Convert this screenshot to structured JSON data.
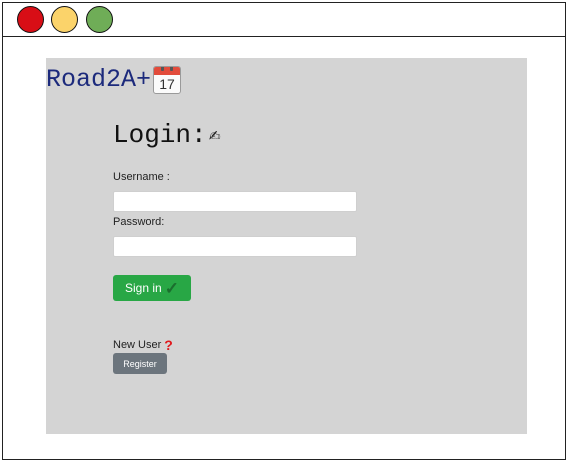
{
  "window": {
    "controls": [
      {
        "name": "close",
        "color": "#d80e16"
      },
      {
        "name": "minimize",
        "color": "#fbd36a"
      },
      {
        "name": "maximize",
        "color": "#6fad57"
      }
    ]
  },
  "brand": {
    "title": "Road2A+",
    "calendar_icon_number": "17",
    "color": "#1c2a7c"
  },
  "login": {
    "heading": "Login:",
    "heading_icon": "writing-hand-icon",
    "username_label": "Username :",
    "username_value": "",
    "password_label": "Password:",
    "password_value": "",
    "signin_label": "Sign in",
    "signin_icon": "check-icon",
    "signin_color": "#28a745"
  },
  "register": {
    "new_user_text": "New User",
    "new_user_icon": "question-mark-icon",
    "register_label": "Register",
    "register_color": "#6c757d"
  },
  "colors": {
    "panel_background": "#d4d4d4"
  }
}
